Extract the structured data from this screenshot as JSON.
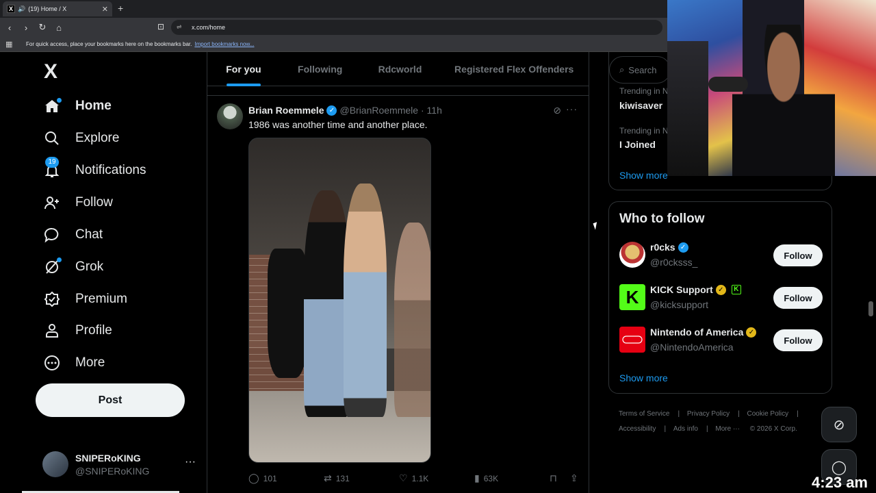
{
  "browser": {
    "tab_title": "(19) Home / X",
    "favicon": "X",
    "url": "x.com/home",
    "bookmarks_text": "For quick access, place your bookmarks here on the bookmarks bar.",
    "bookmarks_link": "Import bookmarks now..."
  },
  "sidebar": {
    "logo": "X",
    "items": [
      {
        "label": "Home",
        "icon": "home-icon"
      },
      {
        "label": "Explore",
        "icon": "search-icon"
      },
      {
        "label": "Notifications",
        "icon": "bell-icon",
        "badge": "19"
      },
      {
        "label": "Follow",
        "icon": "add-person-icon"
      },
      {
        "label": "Chat",
        "icon": "chat-icon"
      },
      {
        "label": "Grok",
        "icon": "grok-icon"
      },
      {
        "label": "Premium",
        "icon": "premium-icon"
      },
      {
        "label": "Profile",
        "icon": "person-icon"
      },
      {
        "label": "More",
        "icon": "more-circle-icon"
      }
    ],
    "post_label": "Post",
    "account": {
      "name": "SNIPERoKING",
      "handle": "@SNIPERoKING"
    }
  },
  "timeline": {
    "tabs": [
      "For you",
      "Following",
      "Rdcworld",
      "Registered Flex Offenders"
    ],
    "tweet": {
      "name": "Brian Roemmele",
      "handle": "@BrianRoemmele",
      "time": "11h",
      "text": "1986 was another time and another place.",
      "replies": "101",
      "reposts": "131",
      "likes": "1.1K",
      "views": "63K"
    }
  },
  "right": {
    "search_placeholder": "Search",
    "trends": [
      {
        "context": "Trending in N",
        "name": "kiwisaver"
      },
      {
        "context": "Trending in N",
        "name": "I Joined"
      }
    ],
    "show_more": "Show more",
    "who_to_follow": {
      "title": "Who to follow",
      "accounts": [
        {
          "name": "r0cks",
          "handle": "@r0cksss_",
          "badge": "blue"
        },
        {
          "name": "KICK Support",
          "handle": "@kicksupport",
          "badge": "gold"
        },
        {
          "name": "Nintendo of America",
          "handle": "@NintendoAmerica",
          "badge": "gold"
        }
      ],
      "follow_label": "Follow",
      "show_more": "Show more"
    },
    "footer": [
      "Terms of Service",
      "Privacy Policy",
      "Cookie Policy",
      "Accessibility",
      "Ads info",
      "More ···",
      "© 2026 X Corp."
    ]
  },
  "overlay": {
    "clock": "4:23 am"
  },
  "colors": {
    "accent": "#1d9bf0",
    "background": "#000000",
    "text": "#e7e9ea",
    "muted": "#71767b",
    "border": "#2f3336"
  }
}
